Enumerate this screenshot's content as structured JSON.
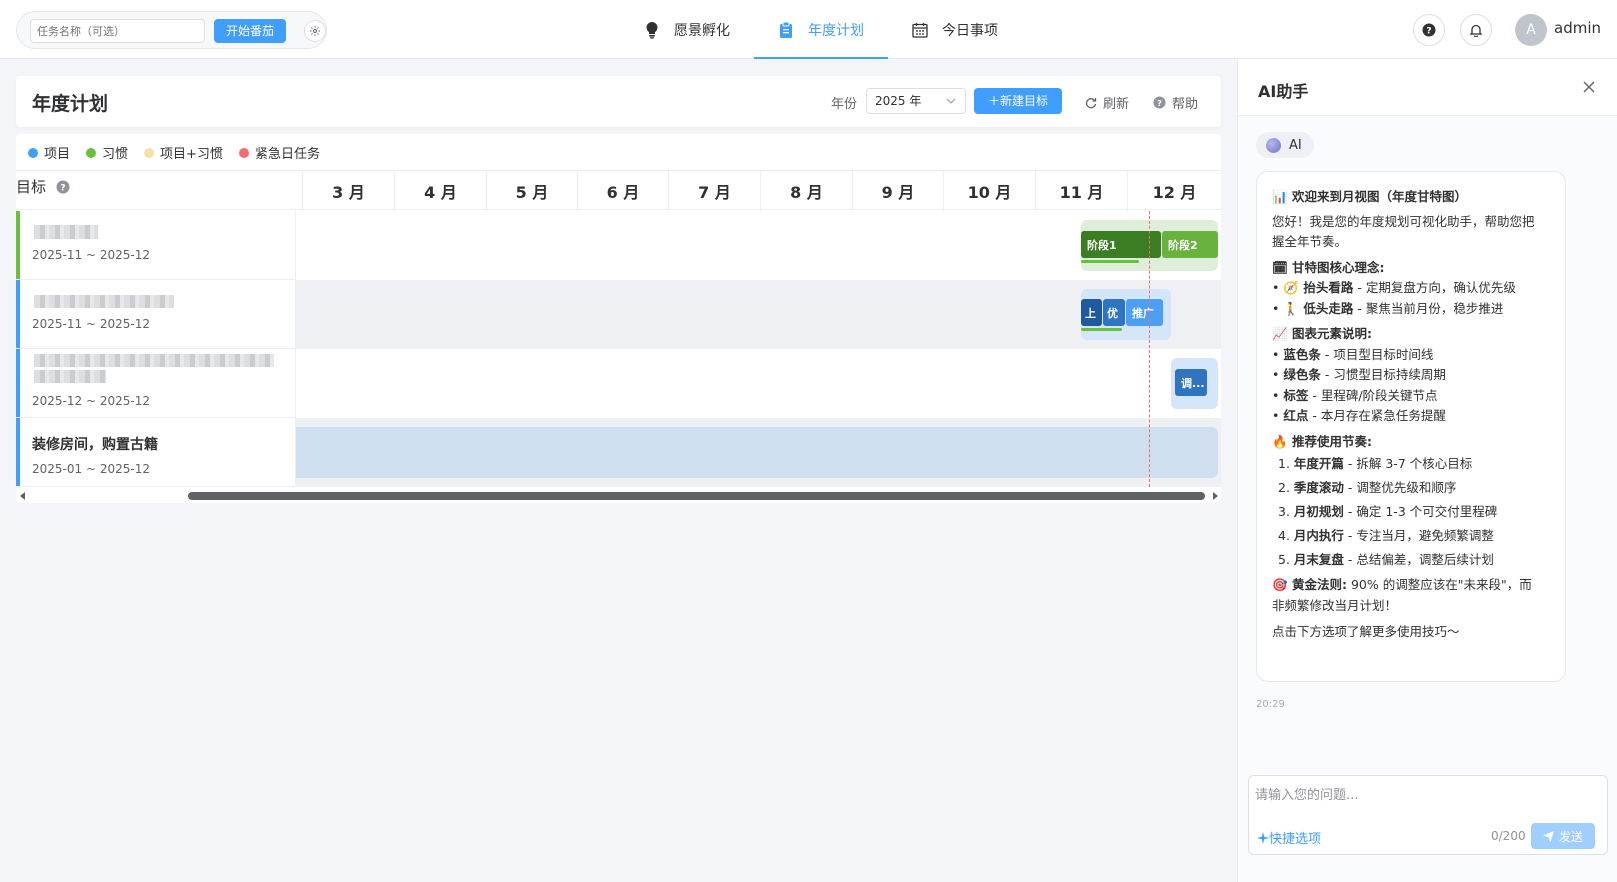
{
  "topbar": {
    "pomodoro": {
      "placeholder": "任务名称（可选）",
      "start_label": "开始番茄"
    },
    "tabs": [
      {
        "label": "愿景孵化",
        "icon": "lightbulb-icon",
        "active": false
      },
      {
        "label": "年度计划",
        "icon": "clipboard-icon",
        "active": true
      },
      {
        "label": "今日事项",
        "icon": "calendar-icon",
        "active": false
      }
    ],
    "user": {
      "avatar_letter": "A",
      "name": "admin"
    }
  },
  "main": {
    "title": "年度计划",
    "year_label": "年份",
    "year_value": "2025 年",
    "new_goal_label": "新建目标",
    "refresh_label": "刷新",
    "help_label": "帮助"
  },
  "gantt": {
    "legend": [
      {
        "label": "项目",
        "color": "#409eff"
      },
      {
        "label": "习惯",
        "color": "#67c23a"
      },
      {
        "label": "项目+习惯",
        "color": "#f3e3a8"
      },
      {
        "label": "紧急日任务",
        "color": "#f56c6c"
      }
    ],
    "goal_column_title": "目标",
    "months": [
      "3 月",
      "4 月",
      "5 月",
      "6 月",
      "7 月",
      "8 月",
      "9 月",
      "10 月",
      "11 月",
      "12 月"
    ],
    "rows": [
      {
        "title": "",
        "date": "2025-11 ~ 2025-12",
        "type": "habit",
        "bar_color": "#67c23a"
      },
      {
        "title": "",
        "date": "2025-11 ~ 2025-12",
        "type": "project",
        "bar_color": "#409eff"
      },
      {
        "title": "",
        "date": "2025-12 ~ 2025-12",
        "type": "project",
        "bar_color": "#409eff"
      },
      {
        "title": "装修房间，购置古籍",
        "date": "2025-01 ~ 2025-12",
        "type": "project",
        "bar_color": "#409eff"
      }
    ],
    "segments": {
      "row1": [
        "阶段1",
        "阶段2"
      ],
      "row2": [
        "上",
        "优",
        "推广"
      ],
      "row3": [
        "调..."
      ]
    }
  },
  "ai": {
    "title": "AI助手",
    "badge": "AI",
    "message": {
      "welcome": "欢迎来到月视图（年度甘特图）",
      "intro": [
        "您好！我是您的年度规划可视化助手，帮助您把",
        "握全年节奏。"
      ],
      "concept_title": "甘特图核心理念:",
      "concepts": [
        {
          "bold": "抬头看路",
          "text": " - 定期复盘方向，确认优先级"
        },
        {
          "bold": "低头走路",
          "text": " - 聚焦当前月份，稳步推进"
        }
      ],
      "elements_title": "图表元素说明:",
      "elements": [
        {
          "bold": "蓝色条",
          "text": " - 项目型目标时间线"
        },
        {
          "bold": "绿色条",
          "text": " - 习惯型目标持续周期"
        },
        {
          "bold": "标签",
          "text": " - 里程碑/阶段关键节点"
        },
        {
          "bold": "红点",
          "text": " - 本月存在紧急任务提醒"
        }
      ],
      "rhythm_title": "推荐使用节奏:",
      "rhythm": [
        {
          "bold": "年度开篇",
          "text": " - 拆解 3-7 个核心目标"
        },
        {
          "bold": "季度滚动",
          "text": " - 调整优先级和顺序"
        },
        {
          "bold": "月初规划",
          "text": " - 确定 1-3 个可交付里程碑"
        },
        {
          "bold": "月内执行",
          "text": " - 专注当月，避免频繁调整"
        },
        {
          "bold": "月末复盘",
          "text": " - 总结偏差，调整后续计划"
        }
      ],
      "golden_title": "黄金法则:",
      "golden_text": "90% 的调整应该在\"未来段\"，而",
      "golden_text2": "非频繁修改当月计划！",
      "footer": "点击下方选项了解更多使用技巧～"
    },
    "time": "20:29",
    "input_placeholder": "请输入您的问题...",
    "quick_label": "快捷选项",
    "counter": "0/200",
    "send_label": "发送"
  }
}
